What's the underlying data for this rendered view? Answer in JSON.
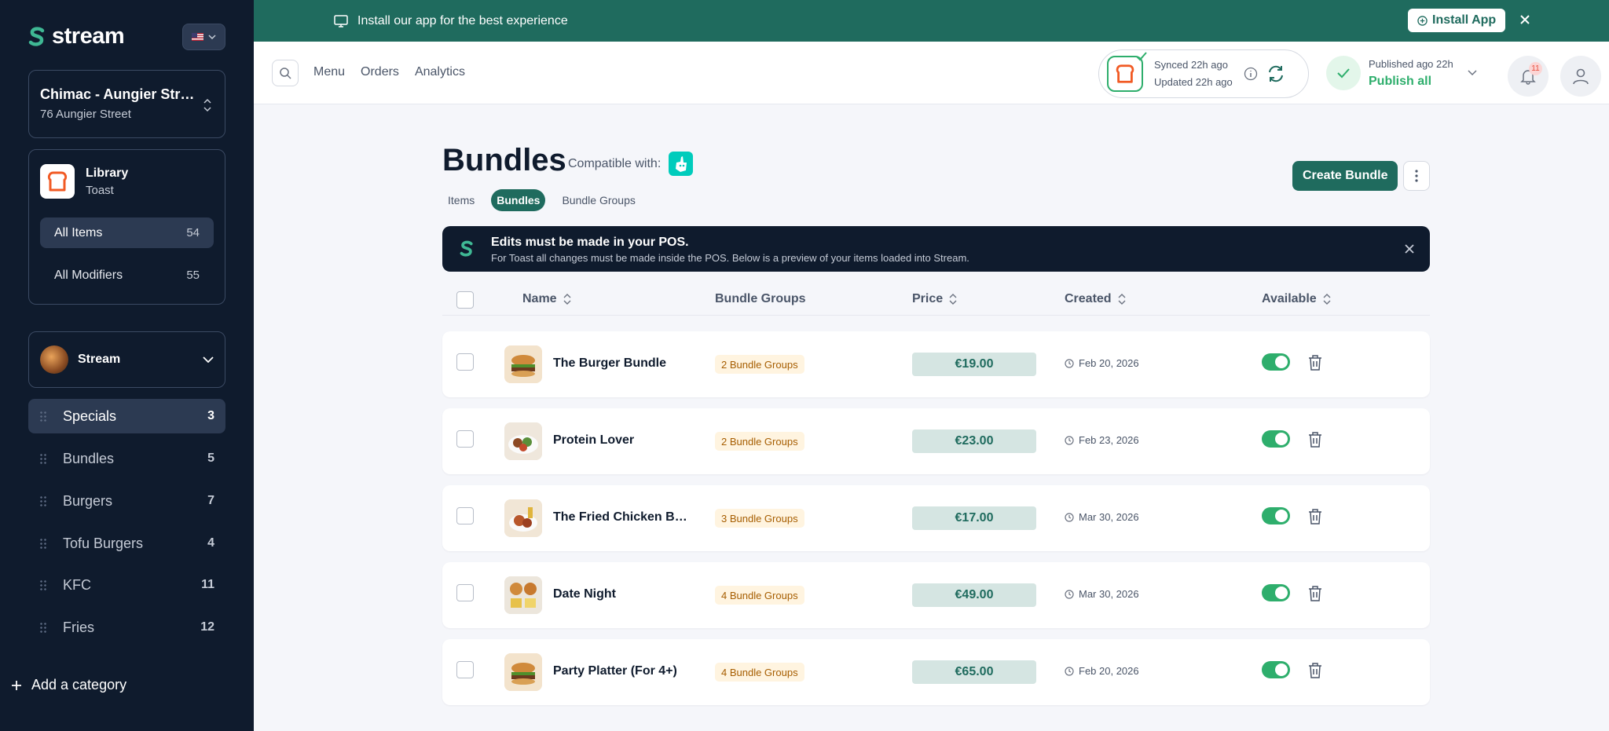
{
  "sidebar": {
    "brand": "stream",
    "location": {
      "name": "Chimac - Aungier Street",
      "address": "76 Aungier Street"
    },
    "library": {
      "title": "Library",
      "source": "Toast",
      "rows": [
        {
          "label": "All Items",
          "count": "54"
        },
        {
          "label": "All Modifiers",
          "count": "55"
        }
      ]
    },
    "menu": {
      "name": "Stream"
    },
    "categories": [
      {
        "label": "Specials",
        "count": "3"
      },
      {
        "label": "Bundles",
        "count": "5"
      },
      {
        "label": "Burgers",
        "count": "7"
      },
      {
        "label": "Tofu Burgers",
        "count": "4"
      },
      {
        "label": "KFC",
        "count": "11"
      },
      {
        "label": "Fries",
        "count": "12"
      }
    ],
    "add_category": "Add a category"
  },
  "install_bar": {
    "message": "Install our app for the best experience",
    "button": "Install App"
  },
  "header": {
    "nav": [
      "Menu",
      "Orders",
      "Analytics"
    ],
    "synced": "Synced 22h ago",
    "updated": "Updated 22h ago",
    "published": "Published ago 22h",
    "publish_all": "Publish all",
    "notification_count": "11"
  },
  "main": {
    "title": "Bundles",
    "compatible_label": "Compatible with:",
    "tabs": [
      "Items",
      "Bundles",
      "Bundle Groups"
    ],
    "create_button": "Create Bundle",
    "pos_banner": {
      "title": "Edits must be made in your POS.",
      "subtitle": "For Toast all changes must be made inside the POS. Below is a preview of your items loaded into Stream."
    },
    "columns": {
      "name": "Name",
      "bundle_groups": "Bundle Groups",
      "price": "Price",
      "created": "Created",
      "available": "Available"
    },
    "rows": [
      {
        "name": "The Burger Bundle",
        "groups": "2 Bundle Groups",
        "price": "€19.00",
        "created": "Feb 20, 2026",
        "available": true
      },
      {
        "name": "Protein Lover",
        "groups": "2 Bundle Groups",
        "price": "€23.00",
        "created": "Feb 23, 2026",
        "available": true
      },
      {
        "name": "The Fried Chicken Bundle",
        "groups": "3 Bundle Groups",
        "price": "€17.00",
        "created": "Mar 30, 2026",
        "available": true
      },
      {
        "name": "Date Night",
        "groups": "4 Bundle Groups",
        "price": "€49.00",
        "created": "Mar 30, 2026",
        "available": true
      },
      {
        "name": "Party Platter (For 4+)",
        "groups": "4 Bundle Groups",
        "price": "€65.00",
        "created": "Feb 20, 2026",
        "available": true
      }
    ]
  },
  "colors": {
    "sidebar_bg": "#0f1b2d",
    "accent": "#1f6b5e",
    "success": "#2eae6c",
    "badge_bg": "#fff4e0",
    "price_bg": "#d5e5e2"
  }
}
